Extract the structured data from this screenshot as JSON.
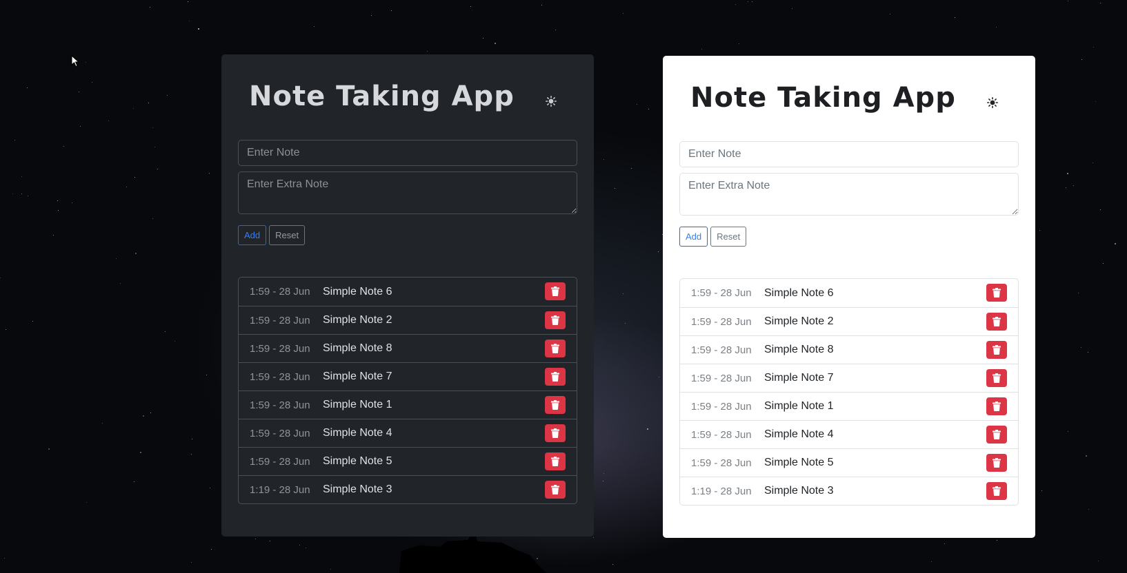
{
  "app": {
    "title": "Note Taking App",
    "theme_icon": "sun-icon",
    "note_placeholder": "Enter Note",
    "extra_placeholder": "Enter Extra Note",
    "add_label": "Add",
    "reset_label": "Reset",
    "delete_icon": "trash-icon"
  },
  "notes": [
    {
      "time": "1:59 - 28 Jun",
      "text": "Simple Note 6"
    },
    {
      "time": "1:59 - 28 Jun",
      "text": "Simple Note 2"
    },
    {
      "time": "1:59 - 28 Jun",
      "text": "Simple Note 8"
    },
    {
      "time": "1:59 - 28 Jun",
      "text": "Simple Note 7"
    },
    {
      "time": "1:59 - 28 Jun",
      "text": "Simple Note 1"
    },
    {
      "time": "1:59 - 28 Jun",
      "text": "Simple Note 4"
    },
    {
      "time": "1:59 - 28 Jun",
      "text": "Simple Note 5"
    },
    {
      "time": "1:19 - 28 Jun",
      "text": "Simple Note 3"
    }
  ],
  "colors": {
    "dark_panel": "#212529",
    "light_panel": "#ffffff",
    "accent": "#0d6efd",
    "danger": "#dc3545"
  }
}
